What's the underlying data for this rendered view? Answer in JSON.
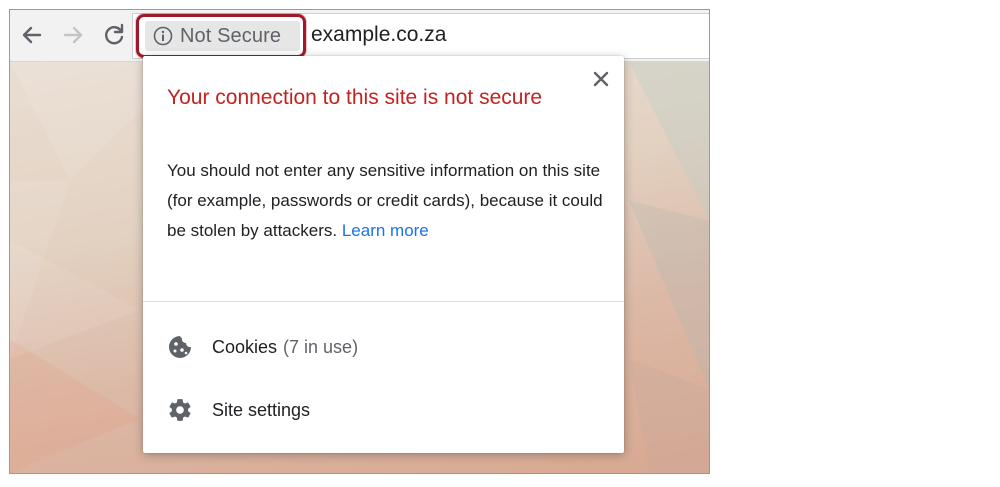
{
  "toolbar": {
    "back_icon": "arrow-back-icon",
    "forward_icon": "arrow-forward-icon",
    "reload_icon": "reload-icon"
  },
  "omnibox": {
    "security_chip": {
      "icon": "info-icon",
      "label": "Not Secure"
    },
    "url": "example.co.za",
    "highlight_color": "#a0182a"
  },
  "popup": {
    "close_icon": "close-icon",
    "title": "Your connection to this site is not secure",
    "title_color": "#c5221f",
    "body": "You should not enter any sensitive information on this site (for example, passwords or credit cards), because it could be stolen by attackers.",
    "learn_more": "Learn more",
    "link_color": "#1a73e8",
    "items": [
      {
        "icon": "cookie-icon",
        "label": "Cookies",
        "detail": "(7 in use)"
      },
      {
        "icon": "gear-icon",
        "label": "Site settings"
      }
    ]
  }
}
